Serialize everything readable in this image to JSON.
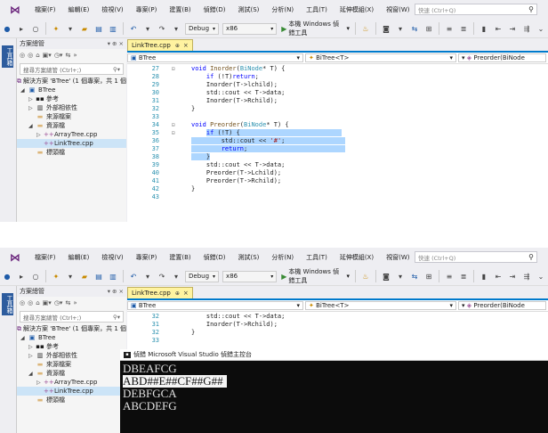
{
  "menu": {
    "items": [
      "檔案(F)",
      "編輯(E)",
      "檢視(V)",
      "專案(P)",
      "建置(B)",
      "偵錯(D)",
      "測試(S)",
      "分析(N)",
      "工具(T)",
      "延伸模組(X)",
      "視窗(W)",
      "說明(H)"
    ],
    "quick_launch_placeholder": "快速 (Ctrl+Q)"
  },
  "toolbar": {
    "config": "Debug",
    "platform": "x86",
    "run_label": "本機 Windows 偵錯工具"
  },
  "side_strip_label": "工具箱",
  "solution_explorer": {
    "title": "方案總管",
    "controls": "▾ ⊕ ×",
    "search_placeholder": "搜尋方案總管 (Ctrl+;)",
    "items": [
      {
        "label": "解決方案 'BTree' (1 個專案，共 1 個)",
        "icon": "solution-icon",
        "glyph": "⧉",
        "depth": 0,
        "expander": ""
      },
      {
        "label": "BTree",
        "icon": "project-icon",
        "glyph": "▣",
        "depth": 0,
        "expander": "◢"
      },
      {
        "label": "參考",
        "icon": "references-icon",
        "glyph": "▪▪",
        "depth": 1,
        "expander": "▷"
      },
      {
        "label": "外部相依性",
        "icon": "external-deps-icon",
        "glyph": "▥",
        "depth": 1,
        "expander": "▷"
      },
      {
        "label": "來源檔案",
        "icon": "folder-icon",
        "glyph": "▬",
        "depth": 1,
        "expander": ""
      },
      {
        "label": "資源檔",
        "icon": "folder-icon",
        "glyph": "▬",
        "depth": 1,
        "expander": "◢"
      },
      {
        "label": "ArrayTree.cpp",
        "icon": "cpp-file-icon",
        "glyph": "++",
        "depth": 2,
        "expander": "▷"
      },
      {
        "label": "LinkTree.cpp",
        "icon": "cpp-file-icon",
        "glyph": "++",
        "depth": 2,
        "expander": ""
      },
      {
        "label": "標頭檔",
        "icon": "folder-icon",
        "glyph": "▬",
        "depth": 1,
        "expander": ""
      }
    ]
  },
  "editor": {
    "tab": "LinkTree.cpp",
    "nav_scope": "BTree",
    "nav_class": "BiTree<T>",
    "nav_member": "Preorder(BiNode"
  },
  "code_top": [
    {
      "ln": "27",
      "fold": "⊟",
      "html": "<span class=\"kw\">void</span> <span class=\"fn\">Inorder</span>(<span class=\"ty\">BiNode</span>* T) {"
    },
    {
      "ln": "28",
      "fold": "",
      "html": "    <span class=\"kw\">if</span> (!T)<span class=\"kw\">return</span>;"
    },
    {
      "ln": "29",
      "fold": "",
      "html": "    Inorder(T-&gt;lchild);"
    },
    {
      "ln": "30",
      "fold": "",
      "html": "    std::cout &lt;&lt; T-&gt;data;"
    },
    {
      "ln": "31",
      "fold": "",
      "html": "    Inorder(T-&gt;Rchild);"
    },
    {
      "ln": "32",
      "fold": "",
      "html": "}"
    },
    {
      "ln": "33",
      "fold": "",
      "html": ""
    },
    {
      "ln": "34",
      "fold": "⊟",
      "html": "<span class=\"kw\">void</span> <span class=\"fn\">Preorder</span>(<span class=\"ty\">BiNode</span>* T) {"
    },
    {
      "ln": "35",
      "fold": "⊟",
      "html": "    <span class=\"sel-bg\"><span class=\"kw\">if</span> (!T) {                           </span>"
    },
    {
      "ln": "36",
      "fold": "",
      "html": "<span class=\"sel-bg\">        std::cout &lt;&lt; <span class=\"st\">'#'</span>;                </span>"
    },
    {
      "ln": "37",
      "fold": "",
      "html": "<span class=\"sel-bg\">        <span class=\"kw\">return</span>;                          </span>"
    },
    {
      "ln": "38",
      "fold": "",
      "html": "<span class=\"sel-bg\">    }</span>"
    },
    {
      "ln": "39",
      "fold": "",
      "html": "    std::cout &lt;&lt; T-&gt;data;"
    },
    {
      "ln": "40",
      "fold": "",
      "html": "    Preorder(T-&gt;Lchild);"
    },
    {
      "ln": "41",
      "fold": "",
      "html": "    Preorder(T-&gt;Rchild);"
    },
    {
      "ln": "42",
      "fold": "",
      "html": "}"
    },
    {
      "ln": "43",
      "fold": "",
      "html": ""
    }
  ],
  "code_bottom": [
    {
      "ln": "32",
      "fold": "",
      "html": "    std::cout &lt;&lt; T-&gt;data;"
    },
    {
      "ln": "31",
      "fold": "",
      "html": "    Inorder(T-&gt;Rchild);"
    },
    {
      "ln": "32",
      "fold": "",
      "html": "}"
    },
    {
      "ln": "33",
      "fold": "",
      "html": ""
    }
  ],
  "console": {
    "title": "偵錯 Microsoft Visual Studio 偵錯主控台",
    "lines": [
      "DBEAFCG",
      "ABD##E##CF##G##",
      "DEBFGCA",
      "ABCDEFG"
    ],
    "highlight_index": 1
  }
}
